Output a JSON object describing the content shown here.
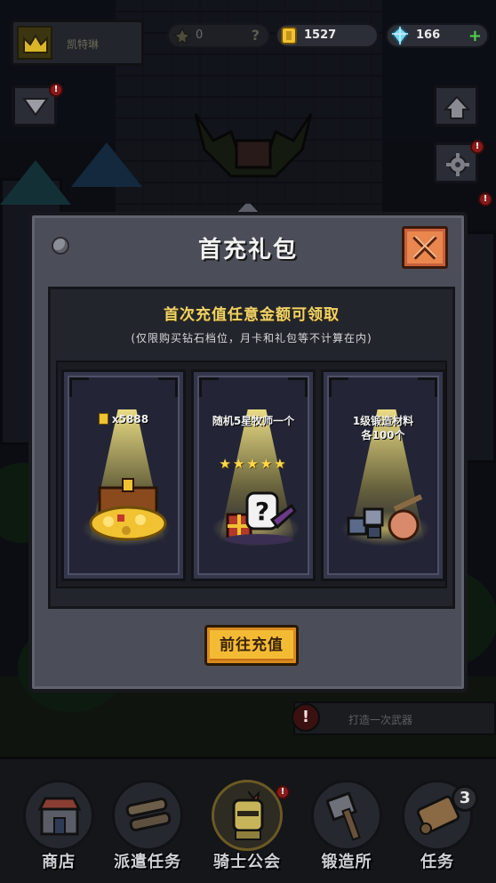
{
  "hud": {
    "rank_name": "凯特琳",
    "medal_value": "0",
    "medal_unknown": "?",
    "gold_value": "1527",
    "gem_value": "166",
    "gem_add": "+"
  },
  "modal": {
    "title": "首充礼包",
    "subtitle": "首次充值任意金额可领取",
    "note": "(仅限购买钻石档位，月卡和礼包等不计算在内)",
    "cta_label": "前往充值",
    "rewards": [
      {
        "label": "x5888",
        "icon": "treasure-chest-icon"
      },
      {
        "label": "随机5星牧师一个",
        "stars": "★★★★★",
        "icon": "mystery-priest-icon"
      },
      {
        "label_line1": "1级锻造材料",
        "label_line2": "各100个",
        "icon": "forge-materials-icon"
      }
    ]
  },
  "background": {
    "task_alert": "!",
    "task_text": "打造一次武器"
  },
  "nav": {
    "items": [
      {
        "label": "商店",
        "icon": "shop-icon"
      },
      {
        "label": "派遣任务",
        "icon": "dispatch-icon"
      },
      {
        "label": "骑士公会",
        "icon": "knight-helmet-icon"
      },
      {
        "label": "锻造所",
        "icon": "anvil-hammer-icon"
      },
      {
        "label": "任务",
        "icon": "scroll-icon",
        "badge": "3"
      }
    ]
  },
  "colors": {
    "gold": "#f3bb34",
    "close_button": "#e9874e",
    "highlight_text": "#f0d36a",
    "gem": "#7dd6f0",
    "plus": "#52d34a"
  }
}
